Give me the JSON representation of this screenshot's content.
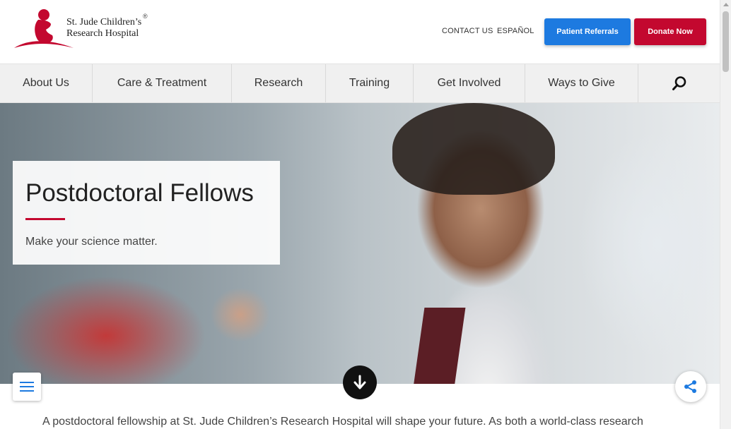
{
  "header": {
    "logo_line1": "St. Jude Children’s",
    "logo_line2": "Research Hospital",
    "logo_reg": "®",
    "util_links": [
      "CONTACT US",
      "ESPAÑOL"
    ],
    "referrals_label": "Patient Referrals",
    "donate_label": "Donate Now"
  },
  "nav": {
    "items": [
      "About Us",
      "Care & Treatment",
      "Research",
      "Training",
      "Get Involved",
      "Ways to Give"
    ]
  },
  "hero": {
    "title": "Postdoctoral Fellows",
    "subtitle": "Make your science matter."
  },
  "intro": {
    "text": "A postdoctoral fellowship at St. Jude Children’s Research Hospital will shape your future. As both a world-class research"
  },
  "colors": {
    "brand_red": "#c3082f",
    "referrals_blue": "#1d7ae0",
    "share_blue": "#1d7ae0"
  },
  "icons": [
    "st-jude-logo-icon",
    "search-icon",
    "hamburger-menu-icon",
    "arrow-down-icon",
    "share-icon"
  ]
}
